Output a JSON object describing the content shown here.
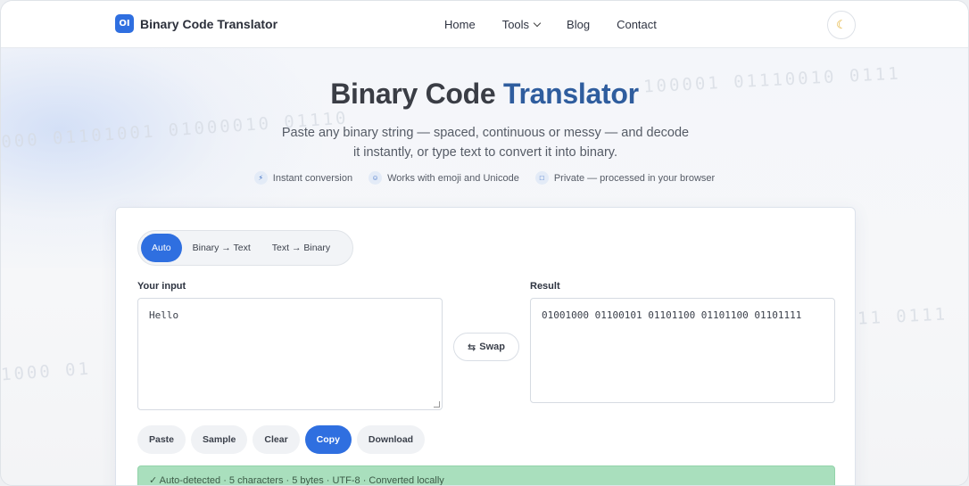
{
  "nav": {
    "logo_text": "OI",
    "brand": "Binary Code Translator",
    "links": {
      "home": "Home",
      "tools": "Tools",
      "blog": "Blog",
      "contact": "Contact"
    },
    "theme_icon": "moon-icon"
  },
  "background": {
    "binary_lines": [
      "000 01101001 01000010 01110",
      "100001 01110010 0111",
      "1000 01",
      "11 0111"
    ]
  },
  "hero": {
    "title_part1": "Binary Code",
    "title_part2": "Translator",
    "subtitle_line1": "Paste any binary string — spaced, continuous or messy — and decode",
    "subtitle_line2": "it instantly, or type text to convert it into binary.",
    "features": [
      {
        "icon": "bolt-icon",
        "label": "Instant conversion"
      },
      {
        "icon": "smile-icon",
        "label": "Works with emoji and Unicode"
      },
      {
        "icon": "lock-icon",
        "label": "Private — processed in your browser"
      }
    ]
  },
  "converter": {
    "modes": [
      "Auto",
      "Binary → Text",
      "Text → Binary"
    ],
    "active_mode": "Auto",
    "input_label": "Your input",
    "input_value": "Hello",
    "result_label": "Result",
    "result_value": "01001000 01100101 01101100 01101100 01101111",
    "swap_label": "Swap",
    "actions": [
      "Paste",
      "Sample",
      "Clear",
      "Copy",
      "Download"
    ],
    "status": "✓ Auto-detected · 5 characters · 5 bytes · UTF-8 · Converted locally"
  },
  "colors": {
    "accent": "#2f6fe0",
    "title_accent": "#2f5d9e",
    "status_bg": "#a9dfbd"
  }
}
